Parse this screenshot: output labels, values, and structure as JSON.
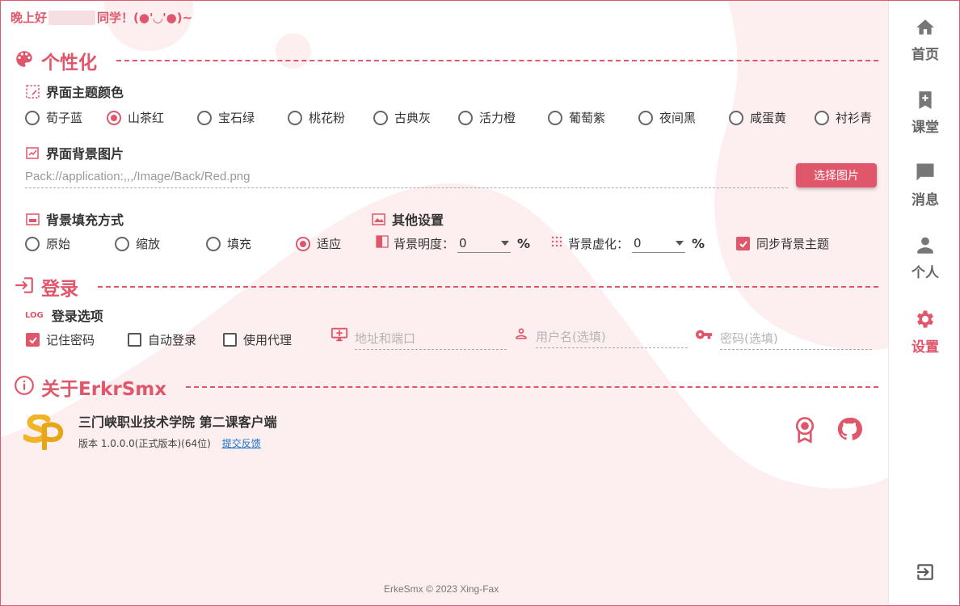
{
  "greeting": {
    "prefix": "晚上好",
    "suffix": "同学！(●'◡'●)~"
  },
  "sections": {
    "personalize": "个性化",
    "login": "登录",
    "about": "关于ErkrSmx"
  },
  "theme": {
    "heading": "界面主题颜色",
    "options": [
      "荀子蓝",
      "山茶红",
      "宝石绿",
      "桃花粉",
      "古典灰",
      "活力橙",
      "葡萄紫",
      "夜间黑",
      "咸蛋黄",
      "衬衫青"
    ],
    "selected": "山茶红"
  },
  "background_image": {
    "heading": "界面背景图片",
    "path": "Pack://application:,,,/Image/Back/Red.png",
    "button": "选择图片"
  },
  "fill_mode": {
    "heading": "背景填充方式",
    "options": [
      "原始",
      "缩放",
      "填充",
      "适应"
    ],
    "selected": "适应"
  },
  "other": {
    "heading": "其他设置",
    "brightness_label": "背景明度：",
    "brightness_value": "0",
    "blur_label": "背景虚化：",
    "blur_value": "0",
    "percent": "%",
    "sync_label": "同步背景主题",
    "sync_checked": true
  },
  "login_options": {
    "heading": "登录选项",
    "log_badge": "LOG",
    "remember": "记住密码",
    "remember_checked": true,
    "auto_login": "自动登录",
    "auto_login_checked": false,
    "proxy": "使用代理",
    "proxy_checked": false,
    "address_placeholder": "地址和端口",
    "username_placeholder": "用户名(选填)",
    "password_placeholder": "密码(选填)"
  },
  "about": {
    "name": "三门峡职业技术学院 第二课客户端",
    "version": "版本 1.0.0.0(正式版本)(64位)",
    "feedback": "提交反馈"
  },
  "footer": "ErkeSmx © 2023 Xing-Fax",
  "nav": [
    {
      "label": "首页",
      "icon": "home-icon"
    },
    {
      "label": "课堂",
      "icon": "bookmark-add-icon"
    },
    {
      "label": "消息",
      "icon": "message-icon"
    },
    {
      "label": "个人",
      "icon": "person-icon"
    },
    {
      "label": "设置",
      "icon": "gear-icon",
      "active": true
    }
  ],
  "colors": {
    "accent": "#e0566a",
    "blob": "#fdeef0"
  }
}
